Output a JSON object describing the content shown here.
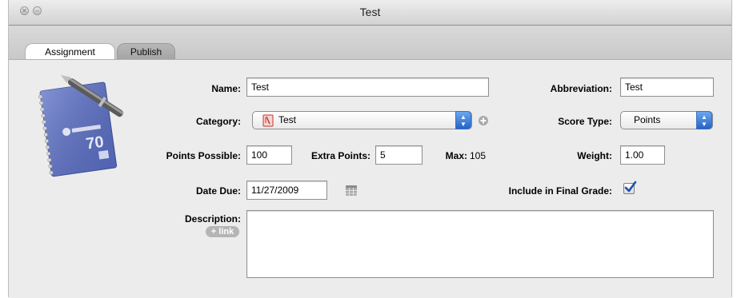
{
  "window": {
    "title": "Test"
  },
  "tabs": [
    {
      "label": "Assignment",
      "active": true
    },
    {
      "label": "Publish",
      "active": false
    }
  ],
  "form": {
    "name_label": "Name:",
    "name_value": "Test",
    "abbreviation_label": "Abbreviation:",
    "abbreviation_value": "Test",
    "category_label": "Category:",
    "category_value": "Test",
    "score_type_label": "Score Type:",
    "score_type_value": "Points",
    "points_possible_label": "Points Possible:",
    "points_possible_value": "100",
    "extra_points_label": "Extra Points:",
    "extra_points_value": "5",
    "max_label": "Max:",
    "max_value": "105",
    "weight_label": "Weight:",
    "weight_value": "1.00",
    "date_due_label": "Date Due:",
    "date_due_value": "11/27/2009",
    "include_label": "Include in Final Grade:",
    "include_checked": true,
    "description_label": "Description:",
    "link_label": "link",
    "description_value": ""
  },
  "icon": {
    "notebook_number": "70"
  },
  "colors": {
    "accent_blue": "#2563c9",
    "category_icon_red": "#c8322a",
    "notebook_blue": "#5b6fc6"
  }
}
